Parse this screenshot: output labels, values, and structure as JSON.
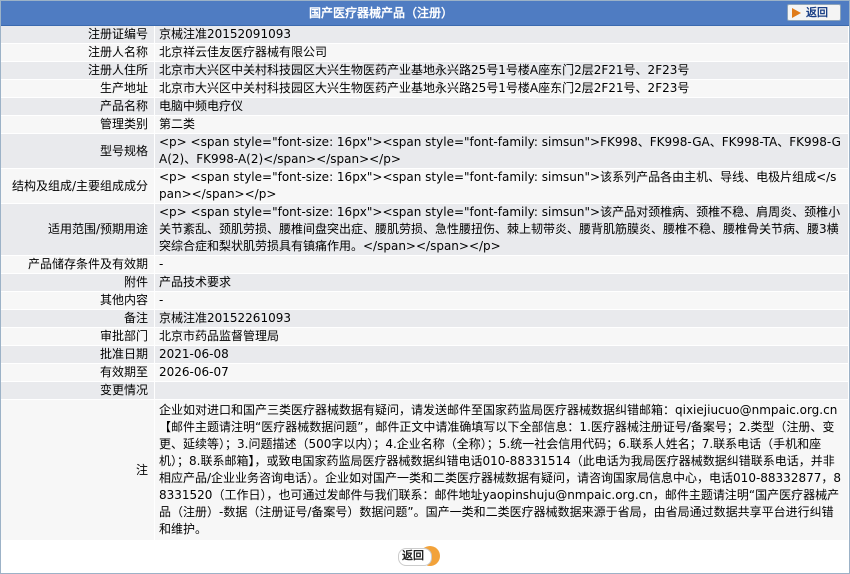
{
  "header": {
    "title": "国产医疗器械产品（注册）",
    "back_label": "返回"
  },
  "rows": [
    {
      "label": "注册证编号",
      "value": "京械注准20152091093",
      "h": 17
    },
    {
      "label": "注册人名称",
      "value": "北京祥云佳友医疗器械有限公司",
      "h": 17
    },
    {
      "label": "注册人住所",
      "value": "北京市大兴区中关村科技园区大兴生物医药产业基地永兴路25号1号楼A座东门2层2F21号、2F23号",
      "h": 17
    },
    {
      "label": "生产地址",
      "value": "北京市大兴区中关村科技园区大兴生物医药产业基地永兴路25号1号楼A座东门2层2F21号、2F23号",
      "h": 17
    },
    {
      "label": "产品名称",
      "value": "电脑中频电疗仪",
      "h": 17
    },
    {
      "label": "管理类别",
      "value": "第二类",
      "h": 17
    },
    {
      "label": "型号规格",
      "value": "<p> <span style=\"font-size: 16px\"><span style=\"font-family: simsun\">FK998、FK998-GA、FK998-TA、FK998-GA(2)、FK998-A(2)</span></span></p>",
      "h": 34
    },
    {
      "label": "结构及组成/主要组成成分",
      "value": "<p> <span style=\"font-size: 16px\"><span style=\"font-family: simsun\">该系列产品各由主机、导线、电极片组成</span></span></p>",
      "h": 34
    },
    {
      "label": "适用范围/预期用途",
      "value": "<p> <span style=\"font-size: 16px\"><span style=\"font-family: simsun\">该产品对颈椎病、颈椎不稳、肩周炎、颈椎小关节紊乱、颈肌劳损、腰椎间盘突出症、腰肌劳损、急性腰扭伤、棘上韧带炎、腰背肌筋膜炎、腰椎不稳、腰椎骨关节病、腰3横突综合症和梨状肌劳损具有镇痛作用。</span></span></p>",
      "h": 51
    },
    {
      "label": "产品储存条件及有效期",
      "value": "-",
      "h": 17
    },
    {
      "label": "附件",
      "value": "产品技术要求",
      "h": 17
    },
    {
      "label": "其他内容",
      "value": "-",
      "h": 17
    },
    {
      "label": "备注",
      "value": "京械注准20152261093",
      "h": 17
    },
    {
      "label": "审批部门",
      "value": "北京市药品监督管理局",
      "h": 17
    },
    {
      "label": "批准日期",
      "value": "2021-06-08",
      "h": 17
    },
    {
      "label": "有效期至",
      "value": "2026-06-07",
      "h": 17
    },
    {
      "label": "变更情况",
      "value": "",
      "h": 17
    },
    {
      "label": "注",
      "value": "企业如对进口和国产三类医疗器械数据有疑问，请发送邮件至国家药监局医疗器械数据纠错邮箱：qixiejiucuo@nmpaic.org.cn【邮件主题请注明“医疗器械数据问题”，邮件正文中请准确填写以下全部信息：1.医疗器械注册证号/备案号；2.类型（注册、变更、延续等）；3.问题描述（500字以内）；4.企业名称（全称）；5.统一社会信用代码；6.联系人姓名；7.联系电话（手机和座机）；8.联系邮箱】，或致电国家药监局医疗器械数据纠错电话010-88331514（此电话为我局医疗器械数据纠错联系电话，并非相应产品/企业业务咨询电话）。企业如对国产一类和二类医疗器械数据有疑问，请咨询国家局信息中心，电话010-88332877，88331520（工作日），也可通过发邮件与我们联系：邮件地址yaopinshuju@nmpaic.org.cn，邮件主题请注明“国产医疗器械产品（注册）-数据（注册证号/备案号）数据问题”。国产一类和二类医疗器械数据来源于省局，由省局通过数据共享平台进行纠错和维护。",
      "h": 138
    }
  ],
  "footer": {
    "back_label": "返回"
  }
}
